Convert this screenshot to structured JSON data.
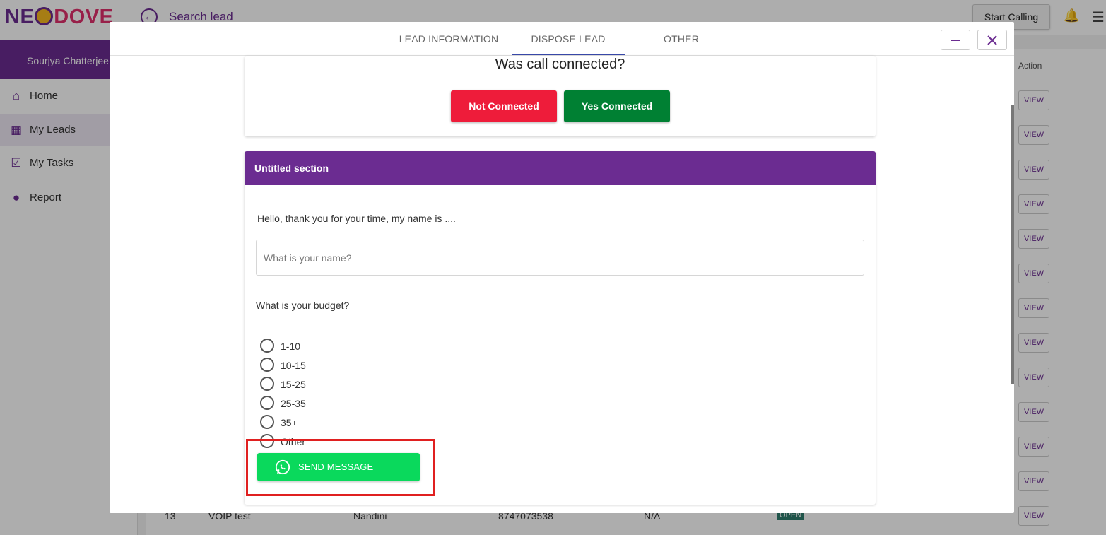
{
  "app": {
    "logo": {
      "left": "NE",
      "right": "DOVE"
    },
    "page_title": "Search lead",
    "start_calling_label": "Start Calling",
    "user_name": "Sourjya Chatterjee"
  },
  "sidebar": {
    "items": [
      {
        "label": "Home",
        "icon": "home-icon"
      },
      {
        "label": "My Leads",
        "icon": "leads-icon"
      },
      {
        "label": "My Tasks",
        "icon": "tasks-icon"
      },
      {
        "label": "Report",
        "icon": "report-icon"
      }
    ]
  },
  "background_table": {
    "action_header": "Action",
    "view_label": "VIEW",
    "last_row": {
      "id": "13",
      "name": "VOIP test",
      "owner": "Nandini",
      "phone": "8747073538",
      "value": "N/A",
      "status": "OPEN"
    }
  },
  "modal": {
    "tabs": [
      {
        "label": "LEAD INFORMATION"
      },
      {
        "label": "DISPOSE LEAD"
      },
      {
        "label": "OTHER"
      }
    ],
    "active_tab": "DISPOSE LEAD",
    "minimize_symbol": "—",
    "close_symbol": "✕",
    "call_question": "Was call connected?",
    "not_connected_label": "Not Connected",
    "yes_connected_label": "Yes Connected",
    "section_title": "Untitled section",
    "greeting": "Hello, thank you for your time, my name is ....",
    "name_placeholder": "What is your name?",
    "budget_question": "What is your budget?",
    "budget_options": [
      {
        "label": "1-10"
      },
      {
        "label": "10-15"
      },
      {
        "label": "15-25"
      },
      {
        "label": "25-35"
      },
      {
        "label": "35+"
      },
      {
        "label": "Other"
      }
    ],
    "send_message_label": "SEND MESSAGE"
  },
  "colors": {
    "brand_purple": "#6b2c91",
    "not_connected_red": "#ee1c3a",
    "yes_connected_green": "#008033",
    "whatsapp_green": "#0ad95c",
    "highlight_red": "#e02020"
  }
}
